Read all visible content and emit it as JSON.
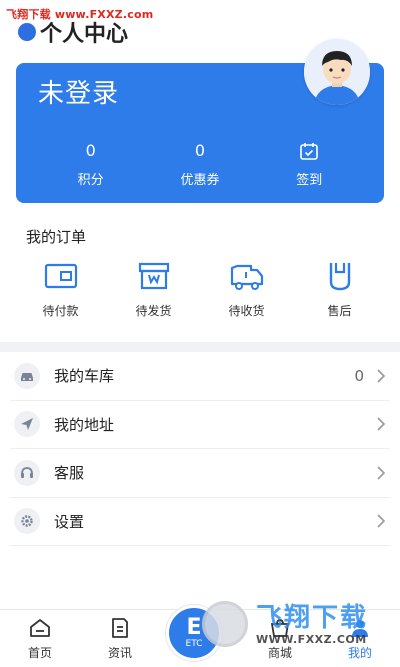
{
  "watermark": {
    "top": "飞翔下载 www.FXXZ.com",
    "bottom_big": "飞翔下载",
    "bottom_small": "WWW.FXXZ.COM"
  },
  "header": {
    "title": "个人中心"
  },
  "profile": {
    "login_text": "未登录",
    "stats": [
      {
        "value": "0",
        "label": "积分"
      },
      {
        "value": "0",
        "label": "优惠券"
      },
      {
        "value": "",
        "label": "签到",
        "icon": "calendar-check-icon"
      }
    ],
    "colors": {
      "card": "#2e7bea"
    }
  },
  "orders": {
    "title": "我的订单",
    "items": [
      {
        "label": "待付款",
        "icon": "wallet-icon"
      },
      {
        "label": "待发货",
        "icon": "package-icon"
      },
      {
        "label": "待收货",
        "icon": "truck-icon"
      },
      {
        "label": "售后",
        "icon": "return-icon"
      }
    ]
  },
  "menu": [
    {
      "label": "我的车库",
      "count": "0",
      "icon": "car-icon"
    },
    {
      "label": "我的地址",
      "count": "",
      "icon": "location-arrow-icon"
    },
    {
      "label": "客服",
      "count": "",
      "icon": "headset-icon"
    },
    {
      "label": "设置",
      "count": "",
      "icon": "gear-icon"
    }
  ],
  "tabbar": {
    "items": [
      {
        "label": "首页",
        "icon": "home-icon"
      },
      {
        "label": "资讯",
        "icon": "news-icon"
      },
      {
        "label": "商城",
        "icon": "shop-icon"
      },
      {
        "label": "我的",
        "icon": "user-icon",
        "active": true
      }
    ],
    "etc": {
      "letter": "E",
      "label": "ETC"
    }
  }
}
